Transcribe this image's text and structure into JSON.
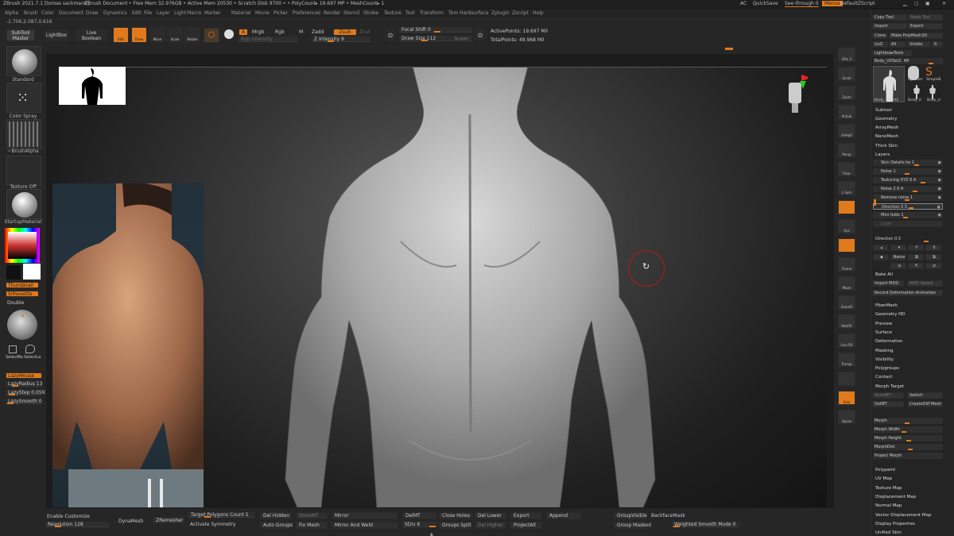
{
  "titlebar": {
    "app": "ZBrush 2021.7.1 [tomas sackmann]",
    "document": "ZBrush Document",
    "stats": "• Free Mem 32.976GB • Active Mem 20530 • Scratch Disk 9700 • • PolyCount▸ 19.697 MP • MeshCount▸ 1",
    "ac": "AC",
    "quicksave": "QuickSave",
    "see_through": "See-through  0",
    "menus": "Menus",
    "default_script": "DefaultZScript"
  },
  "menubar": [
    "Alpha",
    "Brush",
    "Color",
    "Document",
    "Draw",
    "Dynamics",
    "Edit",
    "File",
    "Layer",
    "Light",
    "Macro",
    "Marker",
    "Material",
    "Movie",
    "Picker",
    "Preferences",
    "Render",
    "Stencil",
    "Stroke",
    "Texture",
    "Tool",
    "Transform",
    "Tom Hardsurface",
    "Zplugin",
    "Zscript",
    "Help"
  ],
  "coords": "-1.706,2.087,0.616",
  "toolbar": {
    "subtool_master": "SubTool Master",
    "lightbox": "LightBox",
    "live_boolean": "Live Boolean",
    "edit": "Edit",
    "draw": "Draw",
    "move": "Move",
    "scale": "Scale",
    "rotate": "Rotate",
    "a": "A",
    "mrgb": "Mrgb",
    "rgb": "Rgb",
    "m": "M",
    "zadd": "Zadd",
    "zsub": "Zsub",
    "zcut": "Zcut",
    "rgb_intensity": "Rgb Intensity",
    "z_intensity": "Z Intensity 9",
    "focal_shift": "Focal Shift 0",
    "draw_size": "Draw Size 112",
    "dynamic": "Dynamic",
    "active_points": "ActivePoints: 19.697 Mil",
    "total_points": "TotalPoints: 49.968 Mil"
  },
  "left": {
    "standard": "Standard",
    "color_spray": "Color Spray",
    "brush_alpha": "~BrushAlpha",
    "texture_off": "Texture Off",
    "startup_material": "StartupMaterial",
    "thumbnail": "Thumbnail",
    "silhouette": "Silhouette",
    "double": "Double",
    "select_rect": "SelectRe",
    "select_lasso": "SelectLa",
    "lazymouse": "LazyMouse",
    "lazyradius": "LazyRadius 13",
    "lazystep": "LazyStep 0.0591",
    "lazysmooth": "LazySmooth 0"
  },
  "right_shelf": [
    "SPix 3",
    "Scroll",
    "Zoom",
    "Actual",
    "AAHalf",
    "Persp",
    "Floor",
    "L.Sym",
    "",
    "Xyz",
    "",
    "Frame",
    "Move",
    "ZoomD",
    "RotaTe",
    "Line Fill",
    "Transp",
    "",
    "Solo",
    "Xpose"
  ],
  "palette": {
    "copy_tool": "Copy Tool",
    "paste_tool": "Paste Tool",
    "import": "Import",
    "export": "Export",
    "clone": "Clone",
    "make_polymesh": "Make PolyMesh3D",
    "goz": "GoZ",
    "all": "All",
    "visible": "Visible",
    "r": "R",
    "lightbox_tools": "Lightbox▸Tools",
    "body_uvset": "Body_UVSet2. 48",
    "tool_thumbs": [
      "Body_UVSet2",
      "Cylinder",
      "SimpleB",
      "Body_U",
      "Body_U"
    ],
    "subtool": "Subtool",
    "geometry": "Geometry",
    "arraymesh": "ArrayMesh",
    "nanomesh": "NanoMesh",
    "thick_skin": "Thick Skin",
    "layers": "Layers",
    "layer_items": [
      "Skin Details he 1",
      "Noise 1",
      "Texturing XYZ 0.4",
      "Noise 2 0.4",
      "Remove noise 1",
      "Direction 0.5",
      "Mini folds 1",
      "Layer"
    ],
    "direction": "Direction 0.5",
    "name": "Name",
    "bake_all": "Bake All",
    "import_mdd": "Import MDD",
    "mdd_speed": "MDD Speed",
    "record_deformation": "Record Deformation Animation",
    "sections_a": [
      "FiberMesh",
      "Geometry HD",
      "Preview",
      "Surface",
      "Deformation",
      "Masking",
      "Visibility",
      "Polygroups",
      "Contact",
      "Morph Target"
    ],
    "storemt": "StoreMT",
    "switch": "Switch",
    "delmt": "DelMT",
    "creatediff": "CreateDiff Mesh",
    "morph_sliders": [
      "Morph",
      "Morph Width",
      "Morph Height",
      "MorphDist",
      "Project Morph"
    ],
    "sections_b": [
      "Polypaint",
      "UV Map",
      "Texture Map",
      "Displacement Map",
      "Normal Map",
      "Vector Displacement Map",
      "Display Properties",
      "Unified Skin"
    ]
  },
  "bottom": {
    "enable_customize": "Enable Customize",
    "resolution": "Resolution 128",
    "dynamesh": "DynaMesh",
    "zremesher": "ZRemesher",
    "target_poly": "Target Polygons Count 5",
    "activate_symmetry": "Activate Symmetry",
    "del_hidden": "Del Hidden",
    "auto_groups": "Auto Groups",
    "storemt": "StoreMT",
    "fix_mesh": "Fix Mesh",
    "mirror": "Mirror",
    "mirror_weld": "Mirror And Weld",
    "delmt": "DelMT",
    "sdiv": "SDiv 6",
    "close_holes": "Close Holes",
    "groups_split": "Groups Split",
    "del_lower": "Del Lower",
    "del_higher": "Del Higher",
    "export": "Export",
    "project_all": "ProjectAll",
    "append": "Append",
    "group_visible": "GroupVisible",
    "group_masked": "Group Masked",
    "backface_mask": "BackfaceMask",
    "weighted_smooth": "Weighted Smooth Mode 0"
  }
}
